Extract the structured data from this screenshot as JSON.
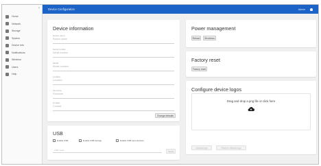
{
  "app": {
    "title": "Device Configuration",
    "user": "Admin"
  },
  "sidebar": {
    "items": [
      {
        "label": "Home",
        "icon": "home-icon"
      },
      {
        "label": "Network",
        "icon": "network-icon"
      },
      {
        "label": "Storage",
        "icon": "storage-icon"
      },
      {
        "label": "System",
        "icon": "system-icon"
      },
      {
        "label": "Device Info",
        "icon": "info-icon"
      },
      {
        "label": "Notifications",
        "icon": "bell-icon"
      },
      {
        "label": "Wireless",
        "icon": "wireless-icon"
      },
      {
        "label": "Users",
        "icon": "users-icon"
      },
      {
        "label": "Help",
        "icon": "help-icon"
      }
    ]
  },
  "device_info": {
    "title": "Device information",
    "fields": [
      {
        "label": "Device name",
        "value": "Device name"
      },
      {
        "label": "Serial number",
        "value": "Serial number"
      },
      {
        "label": "Model",
        "value": "Model number"
      },
      {
        "label": "Location",
        "value": "Location"
      },
      {
        "label": "Firmware",
        "value": "Firmware"
      },
      {
        "label": "Contact",
        "value": "Contact"
      }
    ],
    "save_label": "Change defaults"
  },
  "usb": {
    "title": "USB",
    "options": [
      "Enable USB",
      "Enable USB storage",
      "Enable USB input devices"
    ],
    "input_placeholder": "USB mode",
    "apply_label": "Apply"
  },
  "power": {
    "title": "Power management",
    "reboot_label": "Reboot",
    "shutdown_label": "Shutdown"
  },
  "factory": {
    "title": "Factory reset",
    "reset_label": "Factory reset"
  },
  "logos": {
    "title": "Configure device logos",
    "dropzone_hint": "Drag and drop a png file or click here",
    "upload_label": "Upload logo",
    "restore_label": "Restore default logo"
  }
}
